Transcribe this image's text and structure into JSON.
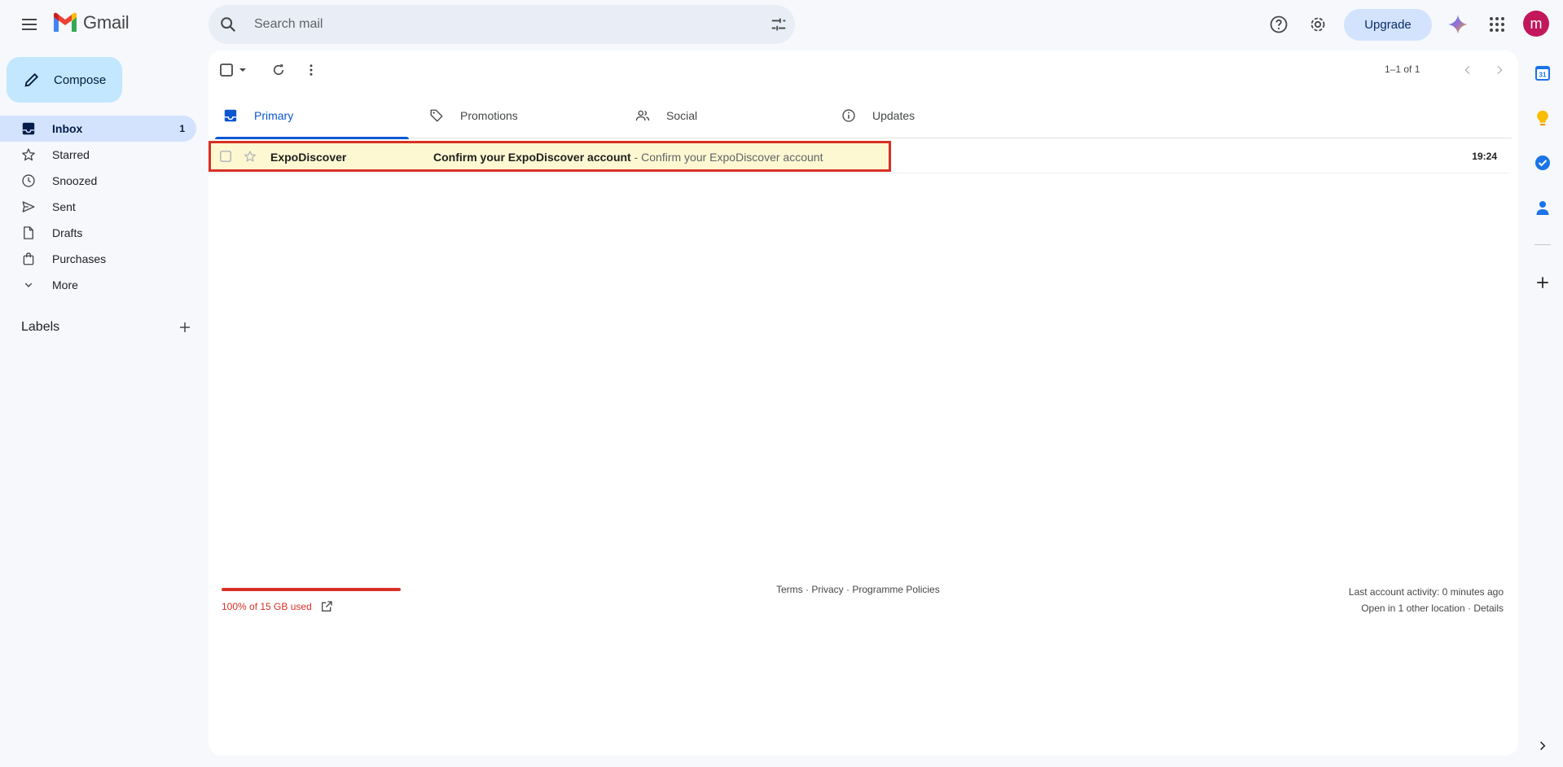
{
  "header": {
    "app_name": "Gmail",
    "search_placeholder": "Search mail",
    "upgrade_label": "Upgrade",
    "avatar_letter": "m"
  },
  "compose_label": "Compose",
  "nav": {
    "items": [
      {
        "label": "Inbox",
        "icon": "inbox-icon",
        "count": "1",
        "active": true
      },
      {
        "label": "Starred",
        "icon": "star-icon"
      },
      {
        "label": "Snoozed",
        "icon": "clock-icon"
      },
      {
        "label": "Sent",
        "icon": "send-icon"
      },
      {
        "label": "Drafts",
        "icon": "draft-icon"
      },
      {
        "label": "Purchases",
        "icon": "shopping-bag-icon"
      },
      {
        "label": "More",
        "icon": "chevron-down-icon"
      }
    ],
    "labels_heading": "Labels"
  },
  "toolbar": {
    "pager": "1–1 of 1"
  },
  "tabs": [
    {
      "label": "Primary",
      "icon": "inbox-icon",
      "active": true
    },
    {
      "label": "Promotions",
      "icon": "tag-icon"
    },
    {
      "label": "Social",
      "icon": "people-icon"
    },
    {
      "label": "Updates",
      "icon": "info-icon"
    }
  ],
  "emails": [
    {
      "sender": "ExpoDiscover",
      "subject": "Confirm your ExpoDiscover account",
      "snippet": " - Confirm your ExpoDiscover account",
      "time": "19:24",
      "unread": true
    }
  ],
  "footer": {
    "storage_used_fraction": 1.0,
    "storage_text": "100% of 15 GB used",
    "terms": "Terms",
    "privacy": "Privacy",
    "policies": "Programme Policies",
    "separator": " · ",
    "last_activity": "Last account activity: 0 minutes ago",
    "other_location": "Open in 1 other location",
    "details": "Details"
  },
  "colors": {
    "accent": "#0b57d0",
    "compose_bg": "#c2e7ff",
    "highlight_border": "#d93025",
    "storage_bar": "#d93025",
    "avatar_bg": "#c2185b"
  }
}
